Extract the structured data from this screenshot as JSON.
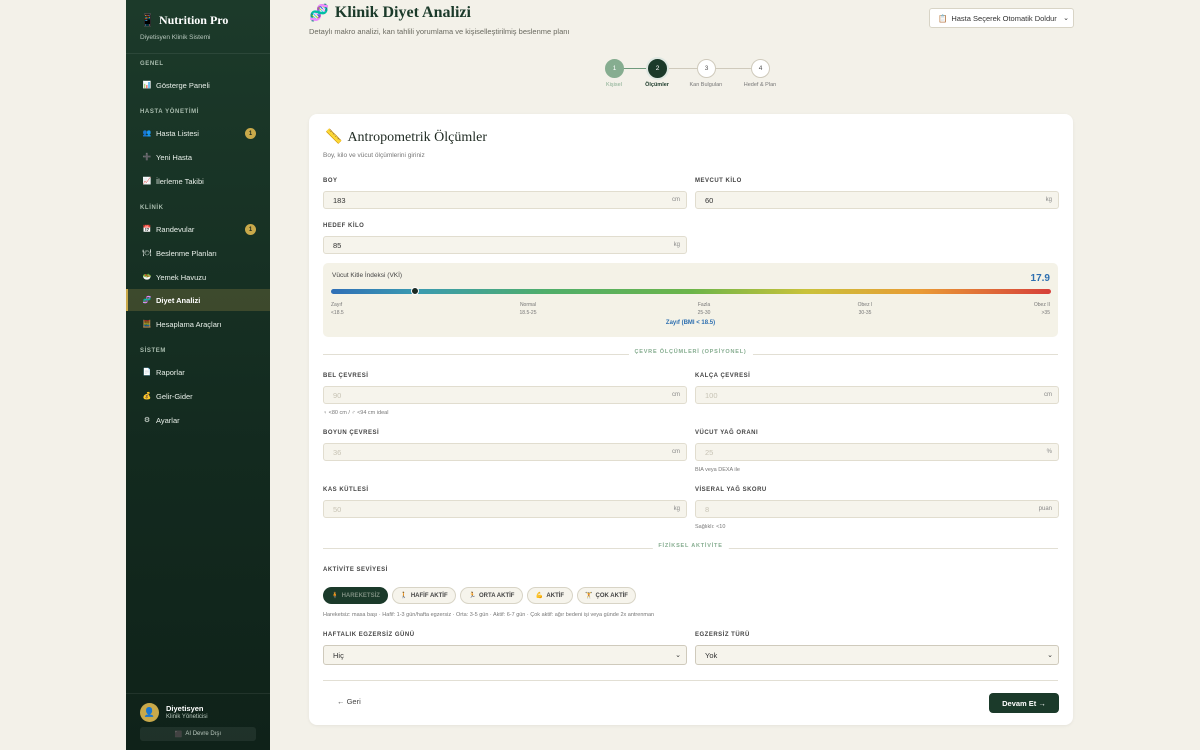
{
  "sidebar": {
    "brand": {
      "title": "Nutrition Pro",
      "subtitle": "Diyetisyen Klinik Sistemi",
      "icon": "📱"
    },
    "sections": {
      "general": "GENEL",
      "patients": "HASTA YÖNETİMİ",
      "clinic": "KLİNİK",
      "system": "SİSTEM"
    },
    "items": [
      {
        "label": "Gösterge Paneli",
        "icon": "📊"
      },
      {
        "label": "Hasta Listesi",
        "icon": "👥",
        "badge": "1"
      },
      {
        "label": "Yeni Hasta",
        "icon": "➕"
      },
      {
        "label": "İlerleme Takibi",
        "icon": "📈"
      },
      {
        "label": "Randevular",
        "icon": "📅",
        "badge": "1"
      },
      {
        "label": "Beslenme Planları",
        "icon": "🍽"
      },
      {
        "label": "Yemek Havuzu",
        "icon": "🥗"
      },
      {
        "label": "Diyet Analizi",
        "icon": "🧬"
      },
      {
        "label": "Hesaplama Araçları",
        "icon": "🧮"
      },
      {
        "label": "Raporlar",
        "icon": "📄"
      },
      {
        "label": "Gelir-Gider",
        "icon": "💰"
      },
      {
        "label": "Ayarlar",
        "icon": "⚙"
      }
    ],
    "user": {
      "name": "Diyetisyen",
      "role": "Klinik Yöneticisi",
      "avatar_icon": "👤",
      "logout_label": "AI Devre Dışı",
      "logout_icon": "⬛"
    }
  },
  "header": {
    "title": "Klinik Diyet Analizi",
    "title_icon": "🧬",
    "subtitle": "Detaylı makro analizi, kan tahlili yorumlama ve kişiselleştirilmiş beslenme planı",
    "patient_select": "Hasta Seçerek Otomatik Doldur",
    "patient_select_icon": "📋"
  },
  "steps": [
    {
      "num": "1",
      "label": "Kişisel"
    },
    {
      "num": "2",
      "label": "Ölçümler"
    },
    {
      "num": "3",
      "label": "Kan Bulguları"
    },
    {
      "num": "4",
      "label": "Hedef & Plan"
    }
  ],
  "card": {
    "title": "Antropometrik Ölçümler",
    "title_icon": "📏",
    "subtitle": "Boy, kilo ve vücut ölçümlerini giriniz",
    "height": {
      "label": "BOY",
      "value": "183",
      "unit": "cm"
    },
    "weight": {
      "label": "MEVCUT KİLO",
      "value": "60",
      "unit": "kg"
    },
    "target": {
      "label": "HEDEF KİLO",
      "value": "85",
      "unit": "kg"
    },
    "bmi": {
      "label": "Vücut Kitle İndeksi (VKİ)",
      "value": "17.9",
      "status": "Zayıf (BMI < 18.5)",
      "ticks": [
        {
          "name": "Zayıf",
          "range": "<18.5"
        },
        {
          "name": "Normal",
          "range": "18.5-25"
        },
        {
          "name": "Fazla",
          "range": "25-30"
        },
        {
          "name": "Obez I",
          "range": "30-35"
        },
        {
          "name": "Obez II",
          "range": ">35"
        }
      ]
    },
    "circ_divider": "ÇEVRE ÖLÇÜMLERİ (OPSİYONEL)",
    "waist": {
      "label": "BEL ÇEVRESİ",
      "placeholder": "90",
      "unit": "cm",
      "hint": "♀ <80 cm / ♂ <94 cm ideal"
    },
    "hip": {
      "label": "KALÇA ÇEVRESİ",
      "placeholder": "100",
      "unit": "cm"
    },
    "neck": {
      "label": "BOYUN ÇEVRESİ",
      "placeholder": "36",
      "unit": "cm"
    },
    "bodyfat": {
      "label": "VÜCUT YAĞ ORANI",
      "placeholder": "25",
      "unit": "%",
      "hint": "BIA veya DEXA ile"
    },
    "muscle": {
      "label": "KAS KÜTLESİ",
      "placeholder": "50",
      "unit": "kg"
    },
    "visceral": {
      "label": "VİSERAL YAĞ SKORU",
      "placeholder": "8",
      "unit": "puan",
      "hint": "Sağlıklı: <10"
    },
    "activity_divider": "FİZİKSEL AKTİVİTE",
    "activity": {
      "label": "AKTİVİTE SEVİYESİ",
      "options": [
        {
          "label": "HAREKETSİZ",
          "icon": "🧍"
        },
        {
          "label": "HAFİF AKTİF",
          "icon": "🚶"
        },
        {
          "label": "ORTA AKTİF",
          "icon": "🏃"
        },
        {
          "label": "AKTİF",
          "icon": "💪"
        },
        {
          "label": "ÇOK AKTİF",
          "icon": "🏋"
        }
      ],
      "hint": "Hareketsiz: masa başı · Hafif: 1-3 gün/hafta egzersiz · Orta: 3-5 gün · Aktif: 6-7 gün · Çok aktif: ağır bedeni işi veya günde 2x antrenman"
    },
    "weekly": {
      "label": "HAFTALIK EGZERSİZ GÜNÜ",
      "value": "Hiç"
    },
    "exercise": {
      "label": "EGZERSİZ TÜRÜ",
      "value": "Yok"
    },
    "back_label": "← Geri",
    "next_label": "Devam Et →"
  }
}
